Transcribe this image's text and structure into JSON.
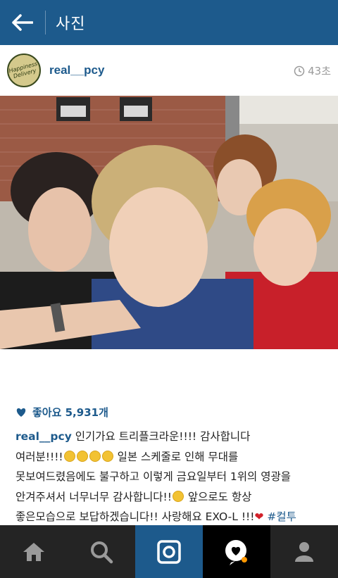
{
  "header": {
    "title": "사진"
  },
  "post": {
    "username": "real__pcy",
    "time": "43초",
    "avatar_text": "Happiness Delivery",
    "likes": "좋아요 5,931개",
    "caption_user": "real__pcy",
    "caption_part1": " 인기가요 트리플크라운!!!! 감사합니다\n여러분!!!!",
    "caption_part2": " 일본 스케줄로 인해 무대를\n못보여드렸음에도 불구하고 이렇게 금요일부터 1위의 영광을\n안겨주셔서 너무너무 감사합니다!!",
    "caption_part3": " 앞으로도 항상\n좋은모습으로 보답하겠습니다!! 사랑해요 EXO-L !!!",
    "caption_heart": "❤",
    "caption_tag": " #컬투"
  },
  "colors": {
    "brand": "#1d5a8c",
    "nav_bg": "#242424",
    "heart": "#d2212a"
  },
  "nav": {
    "items": [
      "home-icon",
      "search-icon",
      "camera-icon",
      "news-icon",
      "profile-icon"
    ]
  }
}
